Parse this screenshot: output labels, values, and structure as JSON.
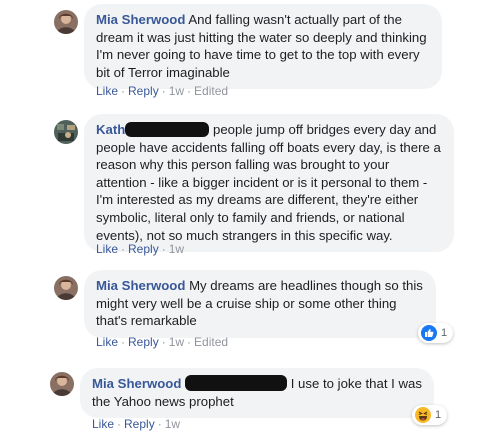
{
  "comments": [
    {
      "author": "Mia Sherwood",
      "text": "And falling wasn't actually part of the dream it was just hitting the water so deeply and thinking I'm never going to have time to get to the top with every bit of Terror imaginable",
      "actions": {
        "like": "Like",
        "reply": "Reply",
        "time": "1w",
        "edited": "Edited"
      }
    },
    {
      "author_fragment": "Kath",
      "text": "people jump off bridges every day and people have accidents falling off boats every day, is there a reason why this person falling was brought to your attention - like a bigger incident or is it personal to them - I'm interested as my dreams are different, they're either symbolic, literal only to family and friends, or national events), not so much strangers in this specific way.",
      "actions": {
        "like": "Like",
        "reply": "Reply",
        "time": "1w"
      }
    },
    {
      "author": "Mia Sherwood",
      "text": "My dreams are headlines though so this might very well be a cruise ship or some other thing that's remarkable",
      "actions": {
        "like": "Like",
        "reply": "Reply",
        "time": "1w",
        "edited": "Edited"
      },
      "reaction": {
        "icon": "like-icon",
        "count": "1",
        "color": "#1877f2"
      }
    },
    {
      "author": "Mia Sherwood",
      "text": "I use to joke that I was the Yahoo news prophet",
      "actions": {
        "like": "Like",
        "reply": "Reply",
        "time": "1w"
      },
      "reaction": {
        "icon": "haha-icon",
        "count": "1",
        "color": "#f7b928"
      }
    }
  ]
}
